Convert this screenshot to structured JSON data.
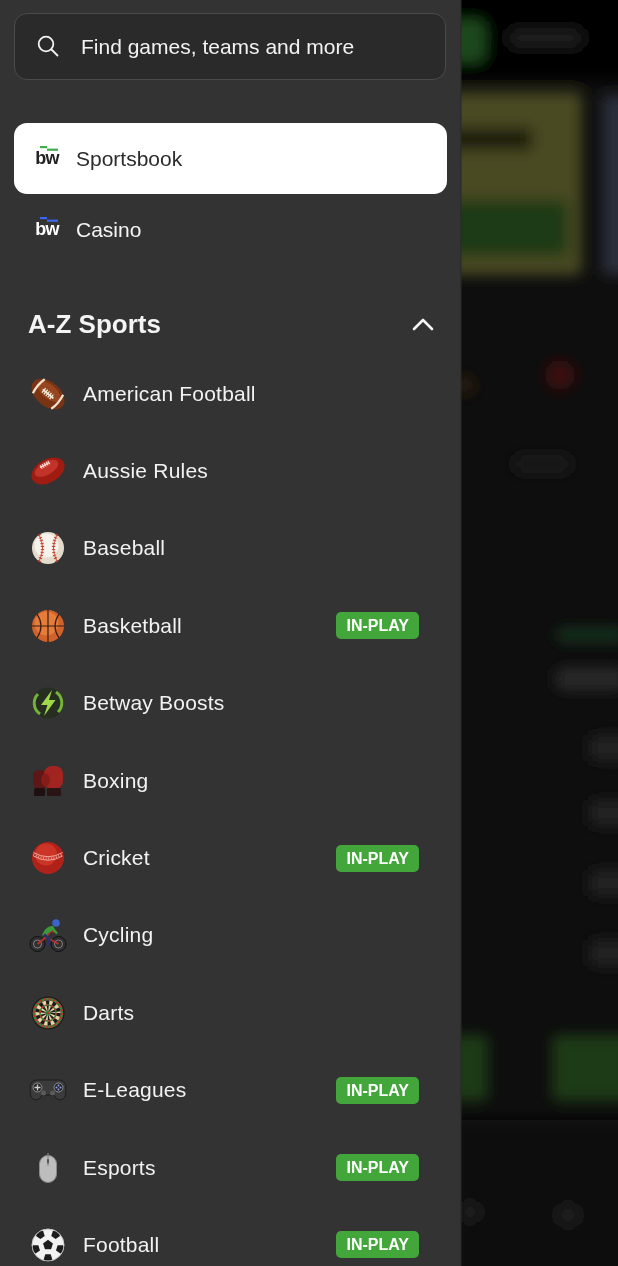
{
  "search": {
    "placeholder": "Find games, teams and more"
  },
  "nav": [
    {
      "logo": "bw",
      "color": "#3fae49",
      "label": "Sportsbook",
      "selected": true
    },
    {
      "logo": "bw",
      "color": "#3d66ee",
      "label": "Casino",
      "selected": false
    }
  ],
  "section": {
    "title": "A-Z Sports",
    "expanded": true,
    "items": [
      {
        "label": "American Football"
      },
      {
        "label": "Aussie Rules"
      },
      {
        "label": "Baseball"
      },
      {
        "label": "Basketball",
        "badge": "IN-PLAY"
      },
      {
        "label": "Betway Boosts"
      },
      {
        "label": "Boxing"
      },
      {
        "label": "Cricket",
        "badge": "IN-PLAY"
      },
      {
        "label": "Cycling"
      },
      {
        "label": "Darts"
      },
      {
        "label": "E-Leagues",
        "badge": "IN-PLAY"
      },
      {
        "label": "Esports",
        "badge": "IN-PLAY"
      },
      {
        "label": "Football",
        "badge": "IN-PLAY"
      }
    ]
  }
}
